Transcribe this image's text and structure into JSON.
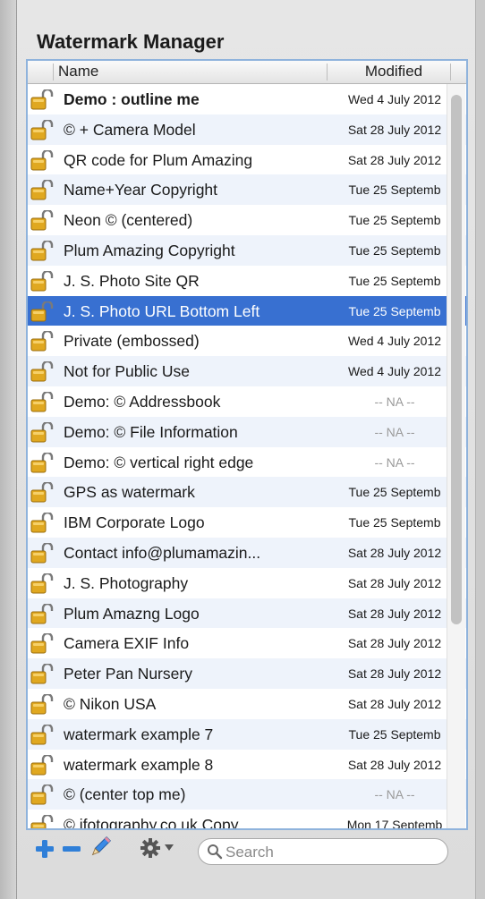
{
  "window": {
    "title": "Watermark Manager"
  },
  "table": {
    "headers": {
      "name": "Name",
      "modified": "Modified"
    },
    "rows": [
      {
        "name": "Demo : outline me",
        "modified": "Wed 4 July 2012",
        "bold": true
      },
      {
        "name": "© + Camera Model",
        "modified": "Sat 28 July 2012"
      },
      {
        "name": "QR code for Plum Amazing",
        "modified": "Sat 28 July 2012"
      },
      {
        "name": "Name+Year Copyright",
        "modified": "Tue 25 Septemb"
      },
      {
        "name": "Neon © (centered)",
        "modified": "Tue 25 Septemb"
      },
      {
        "name": "Plum Amazing Copyright",
        "modified": "Tue 25 Septemb"
      },
      {
        "name": "J. S. Photo Site QR",
        "modified": "Tue 25 Septemb"
      },
      {
        "name": "J. S. Photo URL Bottom Left",
        "modified": "Tue 25 Septemb",
        "selected": true
      },
      {
        "name": "Private (embossed)",
        "modified": "Wed 4 July 2012"
      },
      {
        "name": "Not for Public Use",
        "modified": "Wed 4 July 2012"
      },
      {
        "name": "Demo: ©  Addressbook",
        "modified": "-- NA --"
      },
      {
        "name": "Demo: ©  File Information",
        "modified": "-- NA --"
      },
      {
        "name": "Demo: ©  vertical right edge",
        "modified": "-- NA --"
      },
      {
        "name": "GPS as watermark",
        "modified": "Tue 25 Septemb"
      },
      {
        "name": "IBM Corporate Logo",
        "modified": "Tue 25 Septemb"
      },
      {
        "name": "Contact info@plumamazin...",
        "modified": "Sat 28 July 2012"
      },
      {
        "name": "J. S. Photography",
        "modified": "Sat 28 July 2012"
      },
      {
        "name": "Plum Amazng Logo",
        "modified": "Sat 28 July 2012"
      },
      {
        "name": "Camera EXIF Info",
        "modified": "Sat 28 July 2012"
      },
      {
        "name": "Peter Pan Nursery",
        "modified": "Sat 28 July 2012"
      },
      {
        "name": "© Nikon USA",
        "modified": "Sat 28 July 2012"
      },
      {
        "name": "watermark example 7",
        "modified": "Tue 25 Septemb"
      },
      {
        "name": "watermark example 8",
        "modified": "Sat 28 July 2012"
      },
      {
        "name": "© (center top me)",
        "modified": "-- NA --"
      },
      {
        "name": "© ifotography.co.uk Copy",
        "modified": "Mon 17 Septemb"
      }
    ]
  },
  "toolbar": {
    "add_icon": "plus-icon",
    "remove_icon": "minus-icon",
    "edit_icon": "pencil-icon",
    "actions_icon": "gear-icon",
    "search": {
      "placeholder": "Search",
      "value": ""
    }
  },
  "colors": {
    "selection": "#3870d1",
    "accent_border": "#8fb3dc",
    "lock_gold": "#e0a820",
    "add_blue": "#2f7fd8"
  }
}
